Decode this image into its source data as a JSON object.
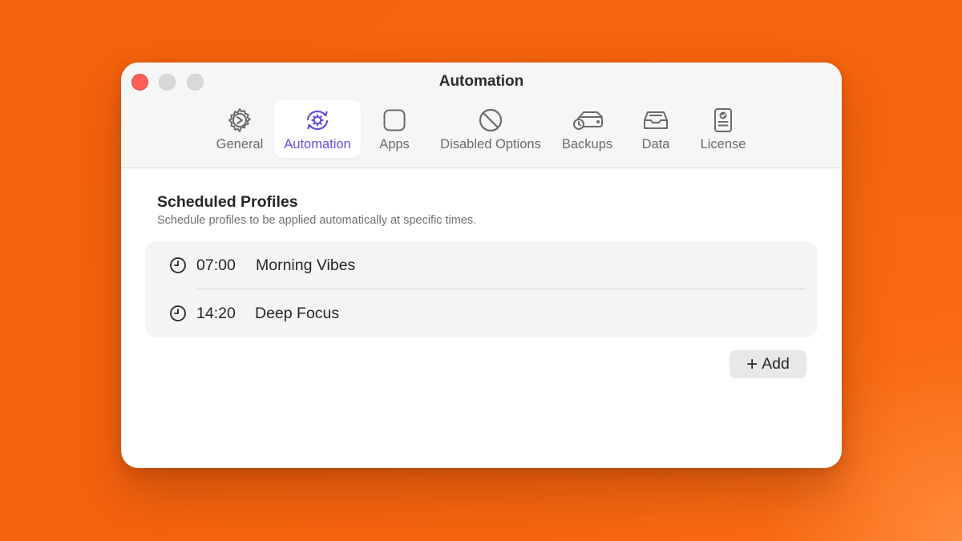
{
  "window": {
    "title": "Automation"
  },
  "toolbar": {
    "tabs": [
      {
        "label": "General",
        "icon": "gear-icon",
        "active": false
      },
      {
        "label": "Automation",
        "icon": "automation-icon",
        "active": true
      },
      {
        "label": "Apps",
        "icon": "apps-icon",
        "active": false
      },
      {
        "label": "Disabled Options",
        "icon": "disabled-icon",
        "active": false
      },
      {
        "label": "Backups",
        "icon": "backups-icon",
        "active": false
      },
      {
        "label": "Data",
        "icon": "data-tray-icon",
        "active": false
      },
      {
        "label": "License",
        "icon": "license-icon",
        "active": false
      }
    ]
  },
  "section": {
    "title": "Scheduled Profiles",
    "subtitle": "Schedule profiles to be applied automatically at specific times."
  },
  "schedules": [
    {
      "time": "07:00",
      "profile": "Morning Vibes",
      "icon": "clock-icon"
    },
    {
      "time": "14:20",
      "profile": "Deep Focus",
      "icon": "clock-icon"
    }
  ],
  "actions": {
    "add_symbol": "+",
    "add_label": "Add"
  },
  "colors": {
    "accent": "#6a4be0",
    "background": "#f6650f",
    "close": "#fe5f57"
  }
}
